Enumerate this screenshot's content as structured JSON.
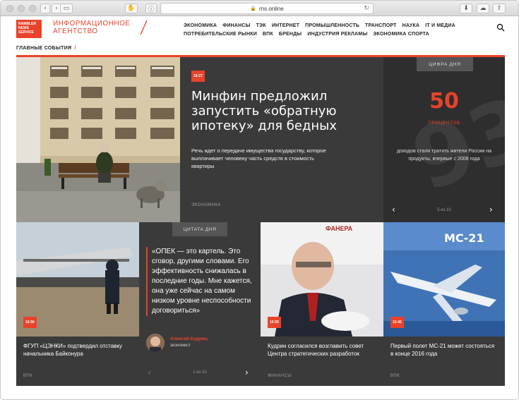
{
  "browser": {
    "url": "rns.online"
  },
  "header": {
    "logo_lines": [
      "RAMBLER",
      "NEWS",
      "SERVICE"
    ],
    "agency_line1": "ИНФОРМАЦИОННОЕ",
    "agency_line2": "АГЕНТСТВО",
    "nav_row1": [
      "ЭКОНОМИКА",
      "ФИНАНСЫ",
      "ТЭК",
      "ИНТЕРНЕТ",
      "ПРОМЫШЛЕННОСТЬ",
      "ТРАНСПОРТ",
      "НАУКА",
      "IT И МЕДИА"
    ],
    "nav_row2": [
      "ПОТРЕБИТЕЛЬСКИЕ РЫНКИ",
      "ВПК",
      "БРЕНДЫ",
      "ИНДУСТРИЯ РЕКЛАМЫ",
      "ЭКОНОМИКА СПОРТА"
    ]
  },
  "section": {
    "title": "ГЛАВНЫЕ СОБЫТИЯ",
    "slash": "/"
  },
  "hero": {
    "time": "16:27",
    "title": "Минфин предложил запустить «обратную ипотеку» для бедных",
    "lead": "Речь идет о передаче имущества государству, которое выплачивает человеку часть средств в стоимость квартиры",
    "category": "ЭКОНОМИКА"
  },
  "figure_of_day": {
    "label": "ЦИФРА ДНЯ",
    "value": "50",
    "unit": "ПРОЦЕНТОВ",
    "description": "доходов стали тратить жители России на продукты, впервые с 2008 года",
    "pager": "5 из 10"
  },
  "cards": [
    {
      "time": "16:56",
      "title": "ФГУП «ЦЭНКИ» подтвердил отставку начальника Байконура",
      "category": "ВПК"
    },
    {
      "time": "16:58",
      "title": "Кудрин согласился возглавить совет Центра стратегических разработок",
      "category": "ФИНАНСЫ"
    },
    {
      "time": "15:45",
      "title": "Первый полет МС-21 может состояться в конце 2016 года",
      "category": "ВПК"
    }
  ],
  "quote": {
    "label": "ЦИТАТА ДНЯ",
    "text": "«ОПЕК — это картель. Это сговор, другими словами. Его эффективность снижалась в последние годы. Мне кажется, она уже сейчас на самом низком уровне неспособности договориться»",
    "author": "Алексей Кудрин,",
    "role": "экономист",
    "pager": "1 из 10"
  },
  "photo_texts": {
    "plane_label": "МС-21",
    "banner_text": "ФАНЕРА"
  },
  "colors": {
    "accent": "#e8432a",
    "dark_tile": "#3a3a3a"
  }
}
